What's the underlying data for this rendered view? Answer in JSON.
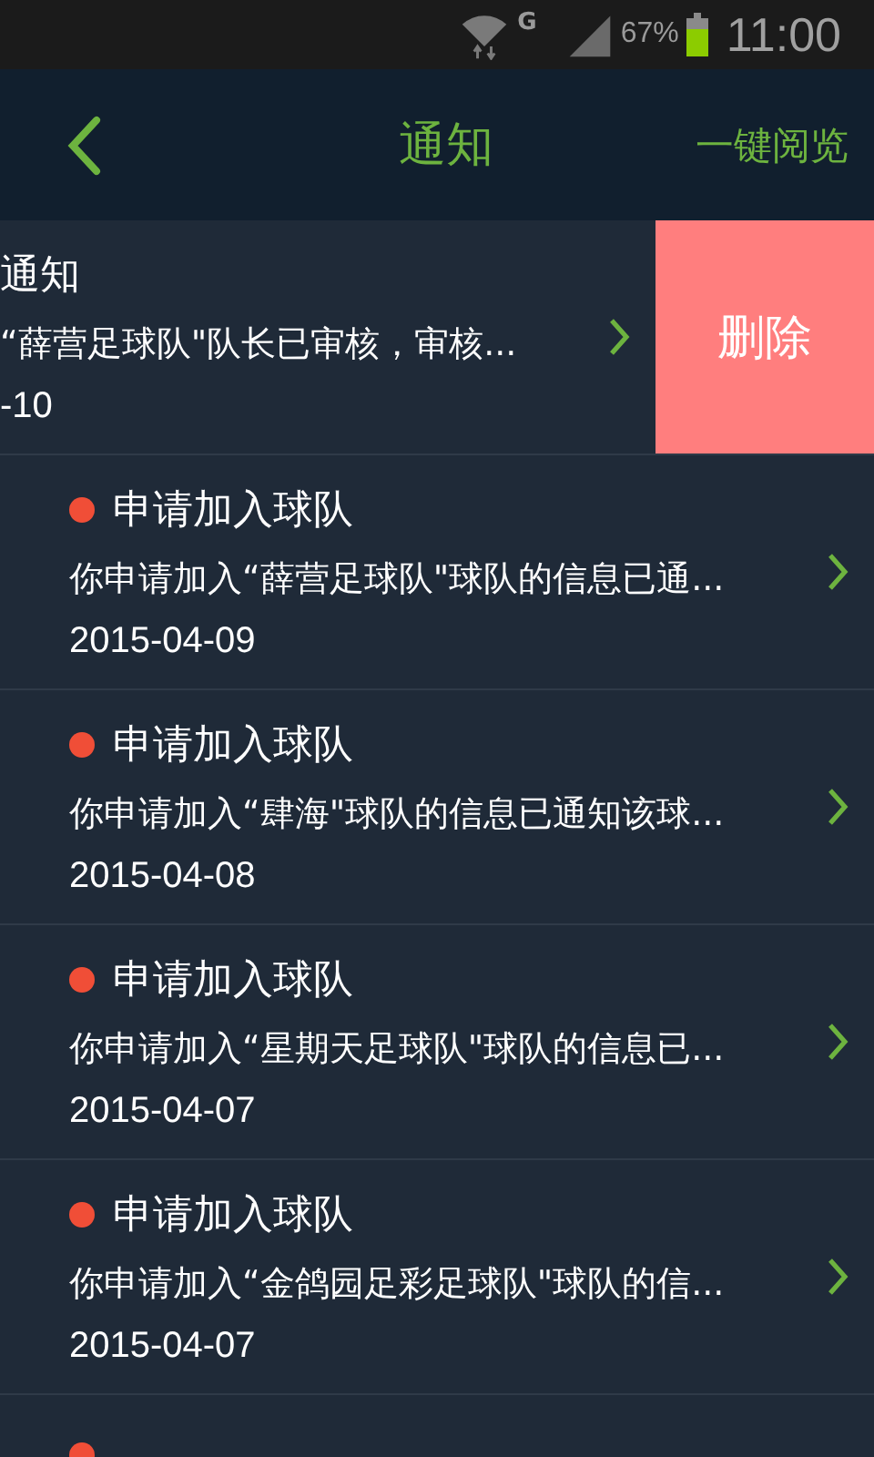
{
  "status_bar": {
    "network": "G",
    "battery_percent": "67%",
    "time": "11:00"
  },
  "header": {
    "title": "通知",
    "action": "一键阅览"
  },
  "notifications": [
    {
      "kind": "swiped",
      "unread": false,
      "title": "通知",
      "message": "“薛营足球队\"队长已审核，审核...",
      "date": "-10",
      "delete_label": "删除"
    },
    {
      "kind": "normal",
      "unread": true,
      "title": "申请加入球队",
      "message": "你申请加入“薛营足球队\"球队的信息已通...",
      "date": "2015-04-09"
    },
    {
      "kind": "normal",
      "unread": true,
      "title": "申请加入球队",
      "message": "你申请加入“肆海\"球队的信息已通知该球...",
      "date": "2015-04-08"
    },
    {
      "kind": "normal",
      "unread": true,
      "title": "申请加入球队",
      "message": "你申请加入“星期天足球队\"球队的信息已...",
      "date": "2015-04-07"
    },
    {
      "kind": "normal",
      "unread": true,
      "title": "申请加入球队",
      "message": "你申请加入“金鸽园足彩足球队\"球队的信...",
      "date": "2015-04-07"
    },
    {
      "kind": "partial",
      "unread": true
    }
  ]
}
